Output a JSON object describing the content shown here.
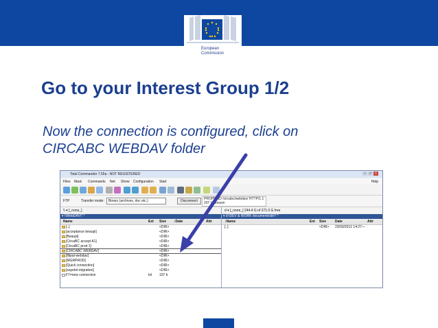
{
  "header": {
    "logo_text_line1": "European",
    "logo_text_line2": "Commission",
    "brand_color": "#0e47a1"
  },
  "slide": {
    "title": "Go to your Interest Group 1/2",
    "subtitle": "Now the connection is configured, click on\nCIRCABC WEBDAV folder"
  },
  "app": {
    "window_title": "Total Commander 7.55a - NOT REGISTERED",
    "menu": [
      "Files",
      "Mark",
      "Commands",
      "Net",
      "Show",
      "Configuration",
      "Start"
    ],
    "help_label": "Help",
    "ftp_label": "FTP",
    "transfer_mode_label": "Transfer mode:",
    "transfer_mode_value": "Binary (archives, doc etc.)",
    "disconnect_label": "Disconnect",
    "log_line1": "PROPFIND /circabc/webdav/ HTTP/1.1",
    "log_line2": "207 Unknown",
    "left_drive": "\\\\  ▾  [_none_]",
    "left_path": "▾ \\\\WebDAV\\*.*",
    "right_drive": "d  ▾  [_none_]  244.4 G of 371.0 G free",
    "right_path": "▾ d:\\DEV & WORK documents\\dir\\*.*",
    "columns": {
      "name": "Name",
      "ext": "Ext",
      "size": "Size",
      "date": "↕Date",
      "attr": "Attr"
    },
    "right_columns": {
      "name": "↕Name",
      "ext": "Ext",
      "size": "Size",
      "date": "Date",
      "attr": "Attr"
    },
    "left_files": [
      {
        "name": "[..]",
        "ext": "",
        "size": "<DIR>",
        "date": ""
      },
      {
        "name": "[acceptance beaupi]",
        "ext": "",
        "size": "<DIR>",
        "date": ""
      },
      {
        "name": "[Beaupi]",
        "ext": "",
        "size": "<DIR>",
        "date": ""
      },
      {
        "name": "[CircaBC accept A1]",
        "ext": "",
        "size": "<DIR>",
        "date": ""
      },
      {
        "name": "[CircaBC prod 1]",
        "ext": "",
        "size": "<DIR>",
        "date": ""
      },
      {
        "name": "[CIRCABC WEBDAV]",
        "ext": "",
        "size": "<DIR>",
        "date": ""
      },
      {
        "name": "[filipal-webdav]",
        "ext": "",
        "size": "<DIR>",
        "date": ""
      },
      {
        "name": "[MGRPROD]",
        "ext": "",
        "size": "<DIR>",
        "date": ""
      },
      {
        "name": "[Quick connection]",
        "ext": "",
        "size": "<DIR>",
        "date": ""
      },
      {
        "name": "[sayetol-migration]",
        "ext": "",
        "size": "<DIR>",
        "date": ""
      },
      {
        "name": "F7=new connection",
        "ext": "txt",
        "size": "107 b",
        "date": ""
      }
    ],
    "right_files": [
      {
        "name": "[..]",
        "ext": "",
        "size": "<DIR>",
        "date": "23/03/2012 14:27—"
      }
    ],
    "selected_folder": "[CIRCABC WEBDAV]"
  }
}
